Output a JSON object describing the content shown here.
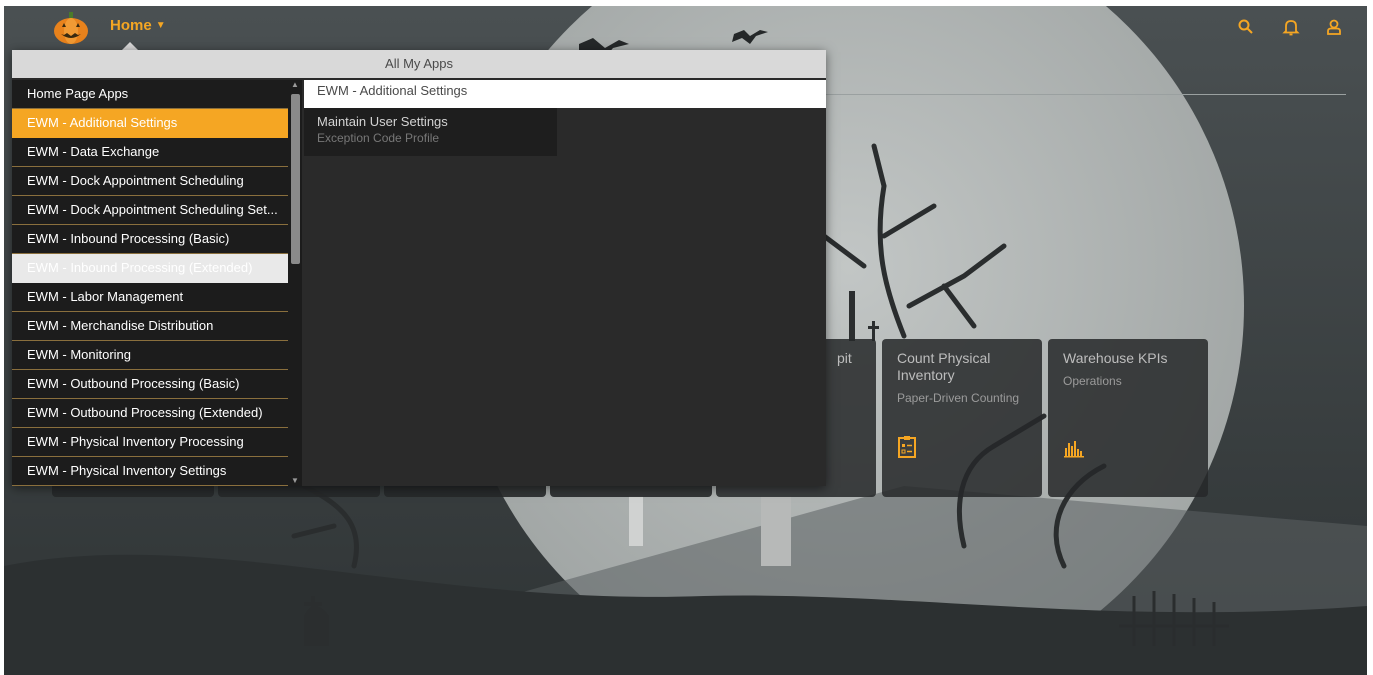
{
  "shell": {
    "title": "Home",
    "logo_icon": "pumpkin-logo-icon",
    "search_icon": "search-icon",
    "notifications_icon": "bell-icon",
    "user_icon": "user-icon",
    "accent_color": "#f5a623"
  },
  "popover": {
    "header": "All My Apps",
    "groups": [
      {
        "label": "Home Page Apps"
      },
      {
        "label": "EWM - Additional Settings"
      },
      {
        "label": "EWM - Data Exchange"
      },
      {
        "label": "EWM - Dock Appointment Scheduling"
      },
      {
        "label": "EWM - Dock Appointment Scheduling Set..."
      },
      {
        "label": "EWM - Inbound Processing (Basic)"
      },
      {
        "label": "EWM - Inbound Processing (Extended)"
      },
      {
        "label": "EWM - Labor Management"
      },
      {
        "label": "EWM - Merchandise Distribution"
      },
      {
        "label": "EWM - Monitoring"
      },
      {
        "label": "EWM - Outbound Processing (Basic)"
      },
      {
        "label": "EWM - Outbound Processing (Extended)"
      },
      {
        "label": "EWM - Physical Inventory Processing"
      },
      {
        "label": "EWM - Physical Inventory Settings"
      }
    ],
    "selected_group": "EWM - Additional Settings",
    "detail": {
      "group_title": "EWM - Additional Settings",
      "apps": [
        {
          "title": "Maintain User Settings",
          "subtitle": "Exception Code Profile"
        }
      ]
    }
  },
  "tiles": [
    {
      "title_fragment": "pit"
    },
    {
      "title": "Count Physical Inventory",
      "subtitle": "Paper-Driven Counting",
      "icon": "clipboard-checklist-icon"
    },
    {
      "title": "Warehouse KPIs",
      "subtitle": "Operations",
      "icon": "bar-chart-icon"
    }
  ]
}
